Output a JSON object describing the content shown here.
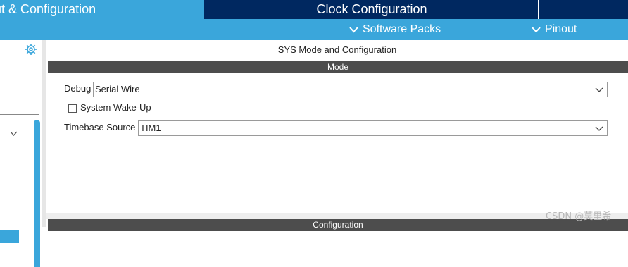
{
  "tabs": {
    "pinout_label": "ut & Configuration",
    "clock_label": "Clock Configuration"
  },
  "menu": {
    "software_packs": "Software Packs",
    "pinout": "Pinout"
  },
  "main": {
    "title": "SYS Mode and Configuration",
    "mode_section": "Mode",
    "config_section": "Configuration",
    "debug": {
      "label": "Debug",
      "value": "Serial Wire"
    },
    "system_wakeup": {
      "label": "System Wake-Up",
      "checked": false
    },
    "timebase": {
      "label": "Timebase Source",
      "value": "TIM1"
    }
  },
  "watermark": "CSDN @莫里希",
  "colors": {
    "accent": "#3aa6db",
    "header_dark": "#002860",
    "section_bar": "#4d4d4d"
  },
  "icons": [
    "gear-icon",
    "chevron-down-icon"
  ]
}
